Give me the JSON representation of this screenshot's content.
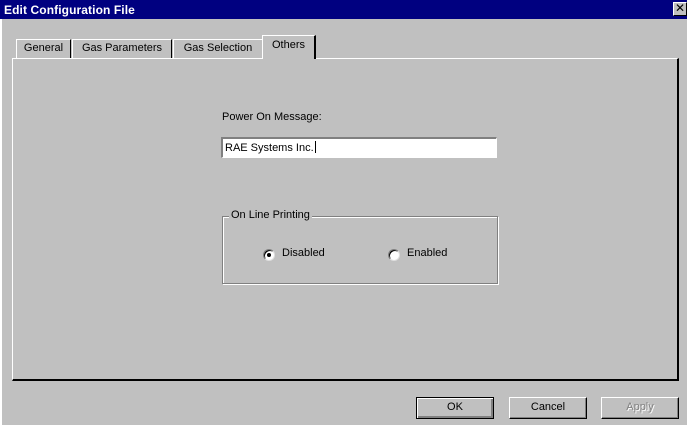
{
  "window": {
    "title": "Edit Configuration File",
    "close_glyph": "✕"
  },
  "tabs": [
    {
      "label": "General",
      "active": false
    },
    {
      "label": "Gas Parameters",
      "active": false
    },
    {
      "label": "Gas Selection",
      "active": false
    },
    {
      "label": "Others",
      "active": true
    }
  ],
  "others": {
    "power_on_label": "Power On Message:",
    "power_on_value": "RAE Systems Inc.",
    "group_title": "On Line Printing",
    "radio_disabled": {
      "label": "Disabled",
      "selected": true
    },
    "radio_enabled": {
      "label": "Enabled",
      "selected": false
    }
  },
  "buttons": {
    "ok": "OK",
    "cancel": "Cancel",
    "apply": "Apply",
    "apply_enabled": false
  },
  "colors": {
    "titlebar": "#000080",
    "face": "#c0c0c0",
    "shadow": "#808080",
    "highlight": "#ffffff"
  }
}
